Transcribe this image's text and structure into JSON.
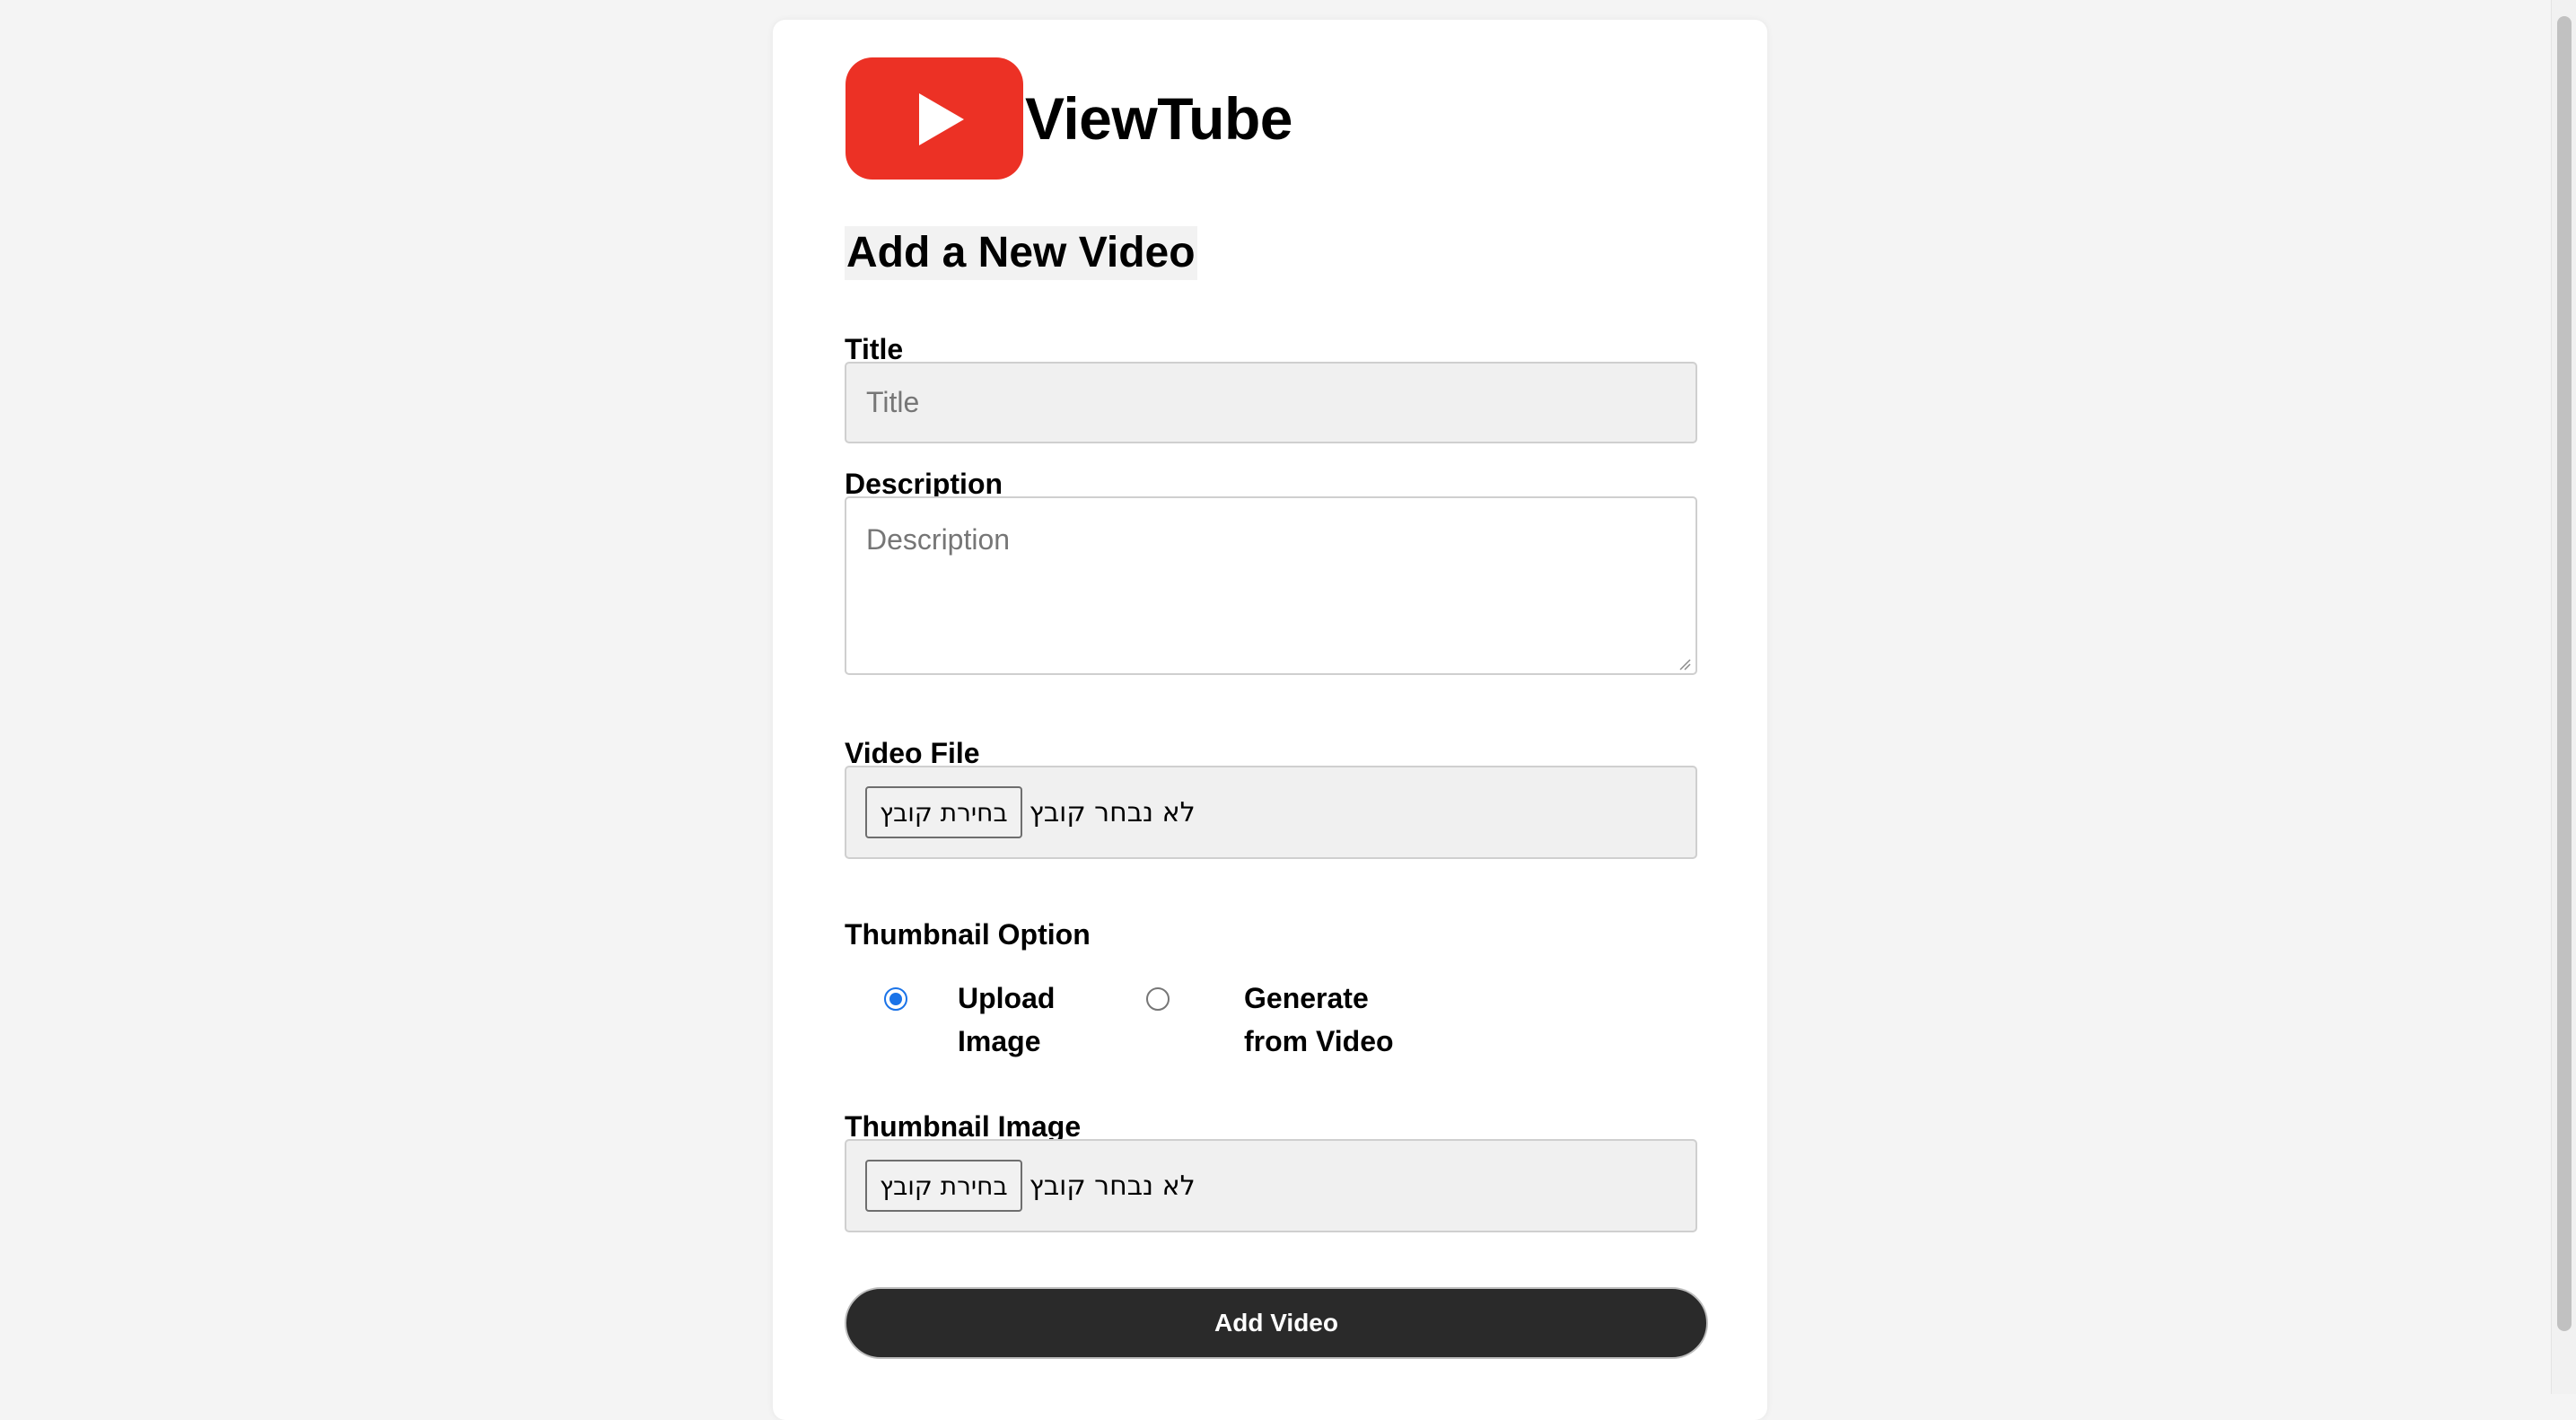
{
  "brand": {
    "name": "ViewTube",
    "logo_icon": "play-icon",
    "logo_color": "#ec3125"
  },
  "form": {
    "heading": "Add a New Video",
    "title": {
      "label": "Title",
      "placeholder": "Title",
      "value": ""
    },
    "description": {
      "label": "Description",
      "placeholder": "Description",
      "value": ""
    },
    "video_file": {
      "label": "Video File",
      "button": "בחירת קובץ",
      "status": "לא נבחר קובץ"
    },
    "thumbnail_option": {
      "label": "Thumbnail Option",
      "options": [
        {
          "label_line1": "Upload",
          "label_line2": "Image",
          "checked": true
        },
        {
          "label_line1": "Generate",
          "label_line2": "from Video",
          "checked": false
        }
      ]
    },
    "thumbnail_image": {
      "label": "Thumbnail Image",
      "button": "בחירת קובץ",
      "status": "לא נבחר קובץ"
    },
    "submit_label": "Add Video"
  },
  "colors": {
    "accent": "#1a73e8",
    "submit_bg": "#2a2a2a"
  }
}
